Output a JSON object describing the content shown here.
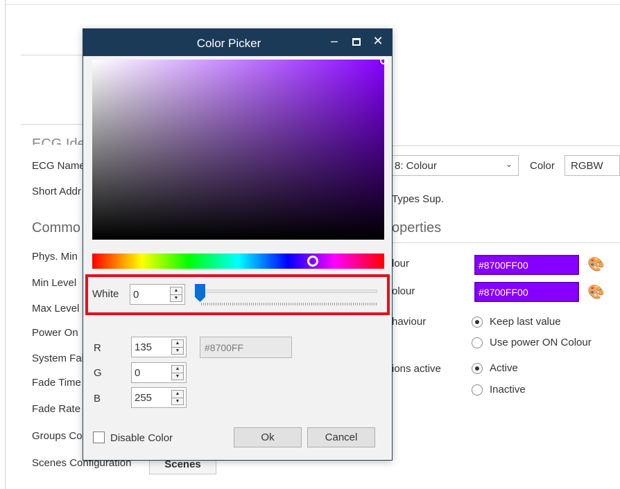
{
  "background": {
    "ecg_section_heading": "ECG Iden",
    "labels": {
      "ecg_name": "ECG Name",
      "short_address": "Short Addr",
      "phys_min": "Phys. Min",
      "min_level": "Min Level",
      "max_level": "Max Level",
      "power_on": "Power On",
      "system_failure": "System Fai",
      "fade_time": "Fade Time",
      "fade_rate": "Fade Rate",
      "groups_config": "Groups Co",
      "scenes_config": "Scenes Configuration"
    },
    "common_heading": "Commo",
    "properties_heading": "operties",
    "device_type_select": "8: Colour",
    "color_label": "Color",
    "color_value": "RGBW",
    "types_supported_label": "Types Sup.",
    "colour1_label": "lour",
    "colour2_label": "olour",
    "colour1_swatch": "#8700FF00",
    "colour2_swatch": "#8700FF00",
    "behaviour_label": "haviour",
    "behaviour_options": [
      "Keep last value",
      "Use power ON Colour"
    ],
    "actions_label": "ions active",
    "actions_options": [
      "Active",
      "Inactive"
    ],
    "scenes_button": "Scenes"
  },
  "dialog": {
    "title": "Color Picker",
    "minimize_glyph": "–",
    "close_glyph": "✕",
    "white_label": "White",
    "white_value": "0",
    "white_slider_fraction": 0.0,
    "r_label": "R",
    "g_label": "G",
    "b_label": "B",
    "r_value": "135",
    "g_value": "0",
    "b_value": "255",
    "hex_value": "#8700FF",
    "disable_color_label": "Disable Color",
    "ok_label": "Ok",
    "cancel_label": "Cancel",
    "current_color": "#8700ff",
    "highlight_color": "#e3101b"
  },
  "icons": {
    "palette": "palette-icon",
    "dropdown": "chevron-down-icon"
  }
}
